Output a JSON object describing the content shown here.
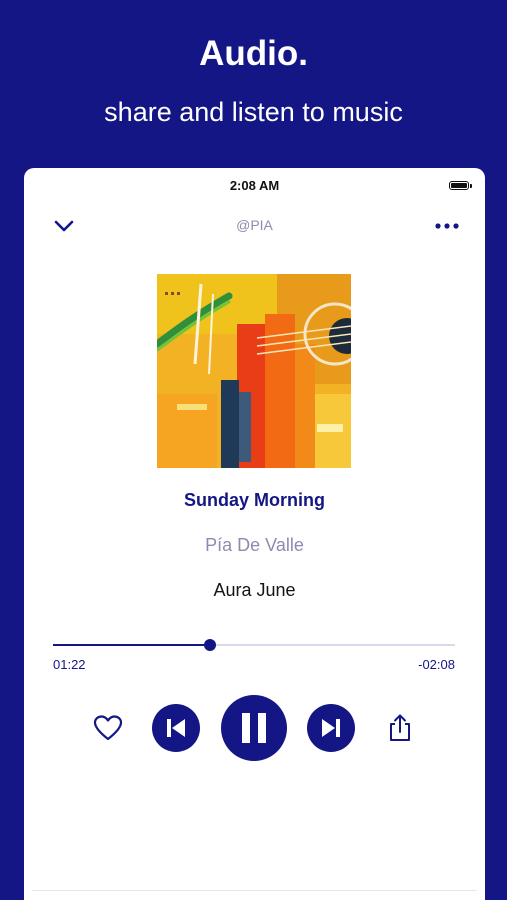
{
  "promo": {
    "headline": "Audio.",
    "tagline": "share and listen to music"
  },
  "status_bar": {
    "time": "2:08 AM",
    "battery_icon": "battery-full-icon"
  },
  "nav": {
    "back_icon": "chevron-down-icon",
    "username": "@PIA",
    "more_icon": "more-horizontal-icon"
  },
  "track": {
    "title": "Sunday Morning",
    "artist": "Pía De Valle",
    "album": "Aura June",
    "cover_art": "abstract-painting-cover"
  },
  "playback": {
    "elapsed": "01:22",
    "remaining": "-02:08",
    "progress_fraction": 0.39
  },
  "controls": {
    "like_icon": "heart-icon",
    "previous_icon": "skip-previous-icon",
    "play_pause_icon": "pause-icon",
    "next_icon": "skip-next-icon",
    "share_icon": "share-icon"
  },
  "colors": {
    "brand": "#141685",
    "muted_text": "#8c8cae",
    "progress_track": "#d9d9ec",
    "background": "#ffffff"
  }
}
